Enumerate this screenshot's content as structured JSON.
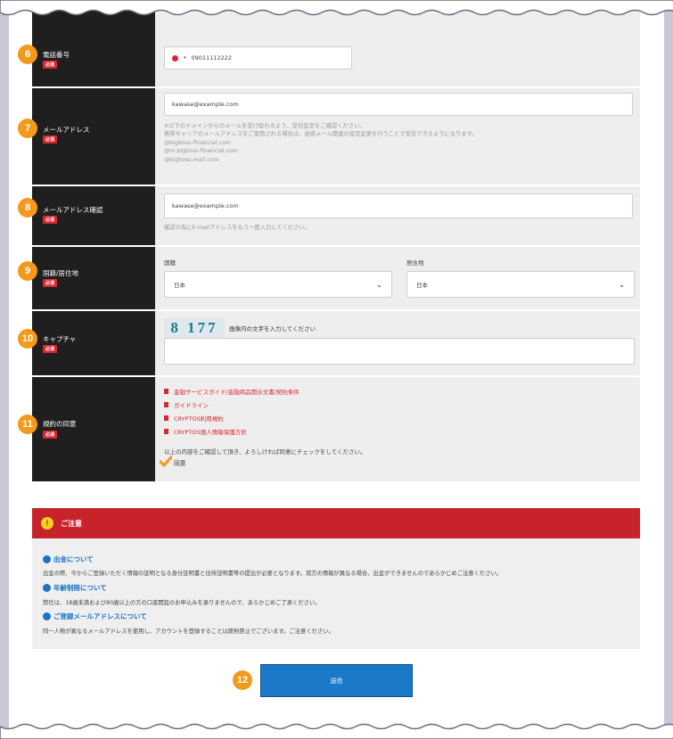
{
  "fields": {
    "phone": {
      "step": "6",
      "label": "電話番号",
      "required": "必須",
      "value": "09011112222"
    },
    "email": {
      "step": "7",
      "label": "メールアドレス",
      "required": "必須",
      "value": "kawase@example.com",
      "note1": "※以下のドメインからのメールを受け取れるよう、受信設定をご確認ください。",
      "note2": "携帯キャリアのメールアドレスをご使用される場合は、迷惑メール関連の設定変更を行うことで受信できるようになります。",
      "domain1": "@bigboss-financial.com",
      "domain2": "@m.bigboss-financial.com",
      "domain3": "@bigboss-mail.com"
    },
    "email_confirm": {
      "step": "8",
      "label": "メールアドレス確認",
      "required": "必須",
      "value": "kawase@example.com",
      "note": "確認の為にE-mailアドレスをもう一度入力してください。"
    },
    "nationality": {
      "step": "9",
      "label": "国籍/居住地",
      "required": "必須",
      "nationality_label": "国籍",
      "nationality_value": "日本",
      "residence_label": "居住地",
      "residence_value": "日本"
    },
    "captcha": {
      "step": "10",
      "label": "キャプチャ",
      "required": "必須",
      "image_text": "8 177",
      "instruction": "画像内の文字を入力してください",
      "value": ""
    },
    "agreement": {
      "step": "11",
      "label": "規約の同意",
      "required": "必須",
      "links": [
        "金融サービスガイド/金融商品開示文書/契約条件",
        "ガイドライン",
        "CRYPTOS利用規約",
        "CRYPTOS個人情報保護方針"
      ],
      "confirm_text": "以上の内容をご確認して頂き、よろしければ同意にチェックをしてください。",
      "checkbox_label": "同意"
    }
  },
  "notice": {
    "title": "ご注意",
    "items": [
      {
        "heading": "出金について",
        "body": "出金の際、今からご登録いただく情報の証明となる身分証明書と住所証明書等の提出が必要となります。双方の情報が異なる場合、出金ができませんのであらかじめご注意ください。"
      },
      {
        "heading": "年齢制限について",
        "body": "弊社は、18歳未満および80歳以上の方の口座開設のお申込みを承りませんので、あらかじめご了承ください。"
      },
      {
        "heading": "ご登録メールアドレスについて",
        "body": "同一人物が異なるメールアドレスを使用し、アカウントを登録することは原則禁止でございます。ご注意ください。"
      }
    ]
  },
  "submit": {
    "step": "12",
    "label": "送信"
  },
  "colors": {
    "accent": "#f39a1c",
    "label_bg": "#1f1f1f",
    "required": "#d9262f",
    "notice_red": "#c8222b",
    "link_blue": "#1a73c8",
    "button": "#1a79c9"
  },
  "icons": {
    "flag": "japan-flag-icon",
    "warning": "warning-icon",
    "doc": "document-icon",
    "check": "checkmark-icon"
  }
}
